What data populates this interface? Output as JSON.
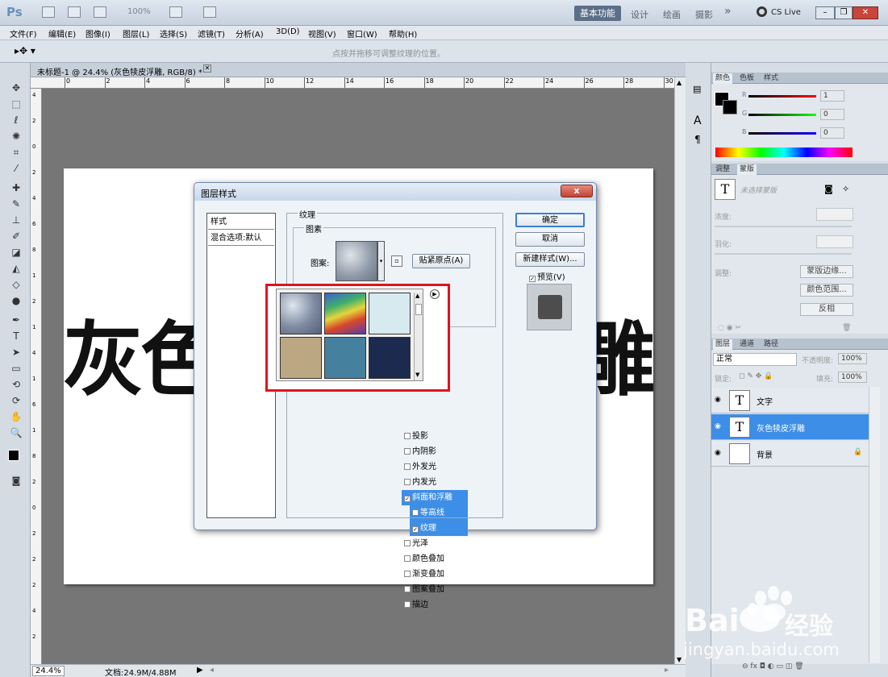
{
  "titlebar": {
    "logo": "Ps",
    "zoom_value": "100%",
    "workspace_active": "基本功能",
    "workspaces": [
      "设计",
      "绘画",
      "摄影"
    ],
    "more": "»",
    "cslive": "CS Live"
  },
  "menu": [
    "文件(F)",
    "编辑(E)",
    "图像(I)",
    "图层(L)",
    "选择(S)",
    "滤镜(T)",
    "分析(A)",
    "3D(D)",
    "视图(V)",
    "窗口(W)",
    "帮助(H)"
  ],
  "options": {
    "hint": "点按并拖移可调整纹理的位置。"
  },
  "document": {
    "tab_title": "未标题-1 @ 24.4% (灰色犊皮浮雕, RGB/8) *",
    "ruler_top": [
      "0",
      "2",
      "4",
      "6",
      "8",
      "10",
      "12",
      "14",
      "16",
      "18",
      "20",
      "22",
      "24",
      "26",
      "28",
      "30"
    ],
    "ruler_left": [
      "4",
      "2",
      "0",
      "2",
      "4",
      "6",
      "8",
      "1",
      "2",
      "1",
      "4",
      "1",
      "6",
      "1",
      "8",
      "2",
      "0",
      "2",
      "2",
      "2",
      "4",
      "2"
    ],
    "canvas_text_left": "灰色",
    "canvas_text_right": "雕"
  },
  "status": {
    "zoom": "24.4%",
    "doc_size": "文档:24.9M/4.88M"
  },
  "panels": {
    "color_tabs": [
      "颜色",
      "色板",
      "样式"
    ],
    "channels": [
      {
        "label": "R",
        "value": "1"
      },
      {
        "label": "G",
        "value": "0"
      },
      {
        "label": "B",
        "value": "0"
      }
    ],
    "adjust_tabs": [
      "调整",
      "蒙版"
    ],
    "mask_title": "未选择蒙版",
    "density_label": "浓度:",
    "feather_label": "羽化:",
    "refine_label": "调整:",
    "mask_buttons": [
      "蒙版边缘...",
      "颜色范围...",
      "反相"
    ],
    "layer_tabs": [
      "图层",
      "通道",
      "路径"
    ],
    "blend_mode": "正常",
    "opacity_label": "不透明度:",
    "opacity_value": "100%",
    "lock_label": "锁定:",
    "fill_label": "填充:",
    "fill_value": "100%",
    "layers": [
      {
        "name": "文字",
        "thumb": "T",
        "selected": false
      },
      {
        "name": "灰色犊皮浮雕",
        "thumb": "T",
        "selected": true
      },
      {
        "name": "背景",
        "thumb": "",
        "selected": false
      }
    ]
  },
  "dialog": {
    "title": "图层样式",
    "close": "x",
    "styles_header": "样式",
    "blend_options": "混合选项:默认",
    "style_items": [
      {
        "label": "投影",
        "checked": false,
        "selected": false,
        "indent": false
      },
      {
        "label": "内阴影",
        "checked": false,
        "selected": false,
        "indent": false
      },
      {
        "label": "外发光",
        "checked": false,
        "selected": false,
        "indent": false
      },
      {
        "label": "内发光",
        "checked": false,
        "selected": false,
        "indent": false
      },
      {
        "label": "斜面和浮雕",
        "checked": true,
        "selected": true,
        "indent": false
      },
      {
        "label": "等高线",
        "checked": false,
        "selected": true,
        "indent": true
      },
      {
        "label": "纹理",
        "checked": true,
        "selected": true,
        "indent": true
      },
      {
        "label": "光泽",
        "checked": false,
        "selected": false,
        "indent": false
      },
      {
        "label": "颜色叠加",
        "checked": false,
        "selected": false,
        "indent": false
      },
      {
        "label": "渐变叠加",
        "checked": false,
        "selected": false,
        "indent": false
      },
      {
        "label": "图案叠加",
        "checked": false,
        "selected": false,
        "indent": false
      },
      {
        "label": "描边",
        "checked": false,
        "selected": false,
        "indent": false
      }
    ],
    "texture_title": "纹理",
    "elements_label": "图素",
    "pattern_label": "图案:",
    "snap_button": "贴紧原点(A)",
    "ok_button": "确定",
    "cancel_button": "取消",
    "new_style_button": "新建样式(W)...",
    "preview_label": "预览(V)"
  },
  "watermark": {
    "brand": "Bai",
    "brand2": "经验",
    "url": "jingyan.baidu.com"
  },
  "colors": {
    "accent": "#3d8ee6",
    "highlight_border": "#e0141b"
  }
}
